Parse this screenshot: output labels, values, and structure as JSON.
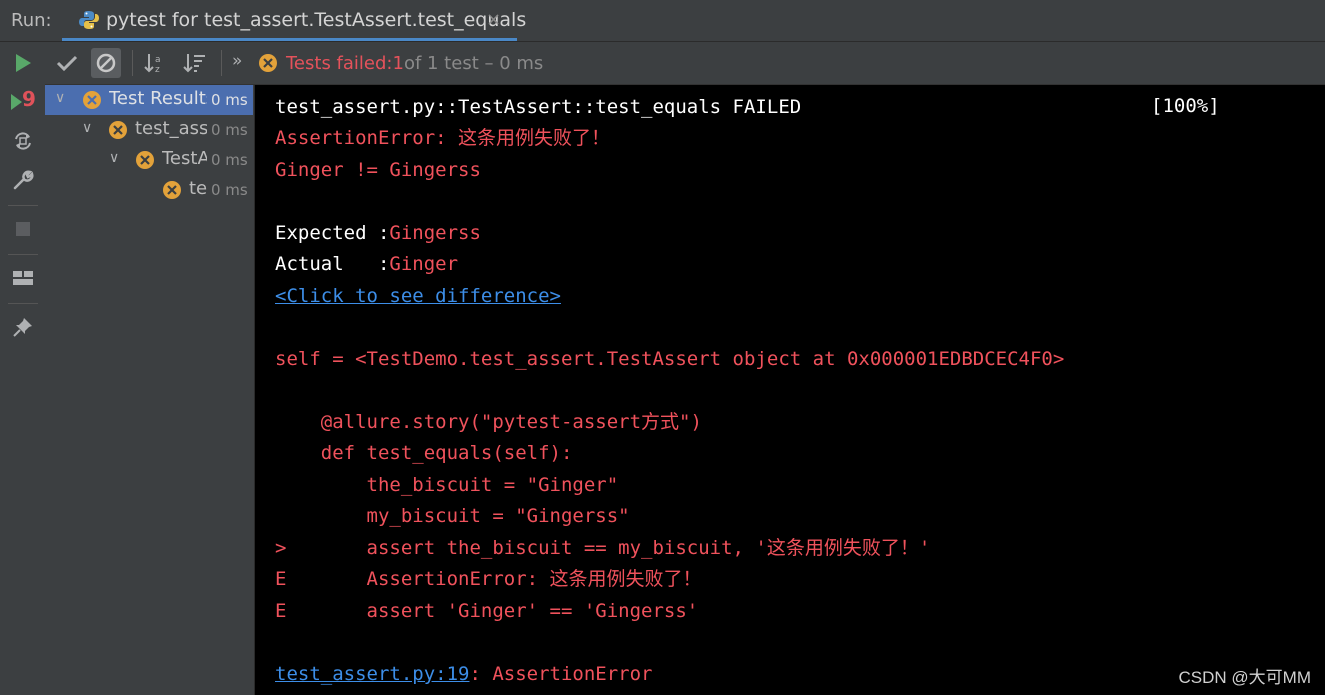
{
  "titlebar": {
    "run_label": "Run:",
    "tab_title": "pytest for test_assert.TestAssert.test_equals",
    "tab_close": "×"
  },
  "toolbar": {
    "overflow": "»",
    "status_prefix": "Tests failed: ",
    "status_failed_count": "1",
    "status_suffix": " of 1 test – 0 ms",
    "left_strip_badge": "9"
  },
  "tree": {
    "items": [
      {
        "name": "Test Results",
        "time": "0 ms"
      },
      {
        "name": "test_asse",
        "time": "0 ms"
      },
      {
        "name": "TestA",
        "time": "0 ms"
      },
      {
        "name": "te",
        "time": "0 ms"
      }
    ]
  },
  "console": {
    "line1": "test_assert.py::TestAssert::test_equals FAILED",
    "percent": "[100%]",
    "line2": "AssertionError: 这条用例失败了！",
    "line3": "Ginger != Gingerss",
    "expected_label": "Expected :",
    "expected_value": "Gingerss",
    "actual_label": "Actual   :",
    "actual_value": "Ginger",
    "diff_link": "<Click to see difference>",
    "self_line": "self = <TestDemo.test_assert.TestAssert object at 0x000001EDBDCEC4F0>",
    "code1": "    @allure.story(\"pytest-assert方式\")",
    "code2": "    def test_equals(self):",
    "code3": "        the_biscuit = \"Ginger\"",
    "code4": "        my_biscuit = \"Gingerss\"",
    "code5": ">       assert the_biscuit == my_biscuit, '这条用例失败了！'",
    "code6": "E       AssertionError: 这条用例失败了！",
    "code7": "E       assert 'Ginger' == 'Gingerss'",
    "footer_link": "test_assert.py:19",
    "footer_rest": ": AssertionError"
  },
  "watermark": "CSDN @大可MM",
  "colors": {
    "background": "#3c3f41",
    "console_bg": "#000000",
    "error_red": "#f0525c",
    "link_blue": "#3d8ee8",
    "accent_blue": "#4a88c7",
    "fail_orange": "#e3a23a",
    "run_green": "#59a869"
  }
}
